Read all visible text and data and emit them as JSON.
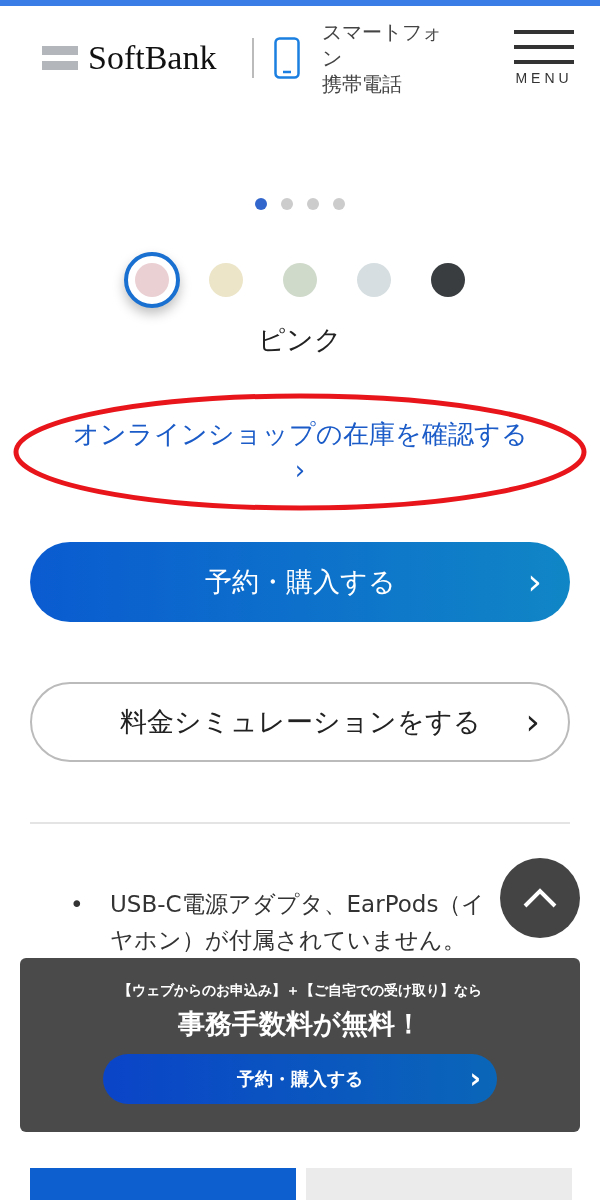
{
  "header": {
    "logo": "SoftBank",
    "category_lines": [
      "スマートフォン",
      "携帯電話"
    ],
    "menu_label": "MENU"
  },
  "carousel_dots": [
    {
      "selected": true
    },
    {
      "selected": false
    },
    {
      "selected": false
    },
    {
      "selected": false
    }
  ],
  "colors": [
    {
      "color": "#ebd0d3",
      "selected": true
    },
    {
      "color": "#ece5c8",
      "selected": false
    },
    {
      "color": "#d0dacb",
      "selected": false
    },
    {
      "color": "#d6dee1",
      "selected": false
    },
    {
      "color": "#3a3d40",
      "selected": false
    }
  ],
  "selected_color_name": "ピンク",
  "stock_link": {
    "label": "オンラインショップの在庫を確認する",
    "icon": "›"
  },
  "buttons": [
    {
      "kind": "primary",
      "label": "予約・購入する",
      "icon": "›"
    },
    {
      "kind": "outline",
      "label": "料金シミュレーションをする",
      "icon": "›"
    }
  ],
  "notes": [
    {
      "bullet": "•",
      "text": "USB-C電源アダプタ、EarPods（イヤホン）が付属されていません。"
    }
  ],
  "banner": {
    "caption": "【ウェブからのお申込み】＋【ご自宅での受け取り】なら",
    "headline": "事務手数料が無料！",
    "button": {
      "label": "予約・購入する",
      "icon": "›"
    }
  },
  "bottom_tabs": [
    {
      "selected": true
    },
    {
      "selected": false
    }
  ]
}
